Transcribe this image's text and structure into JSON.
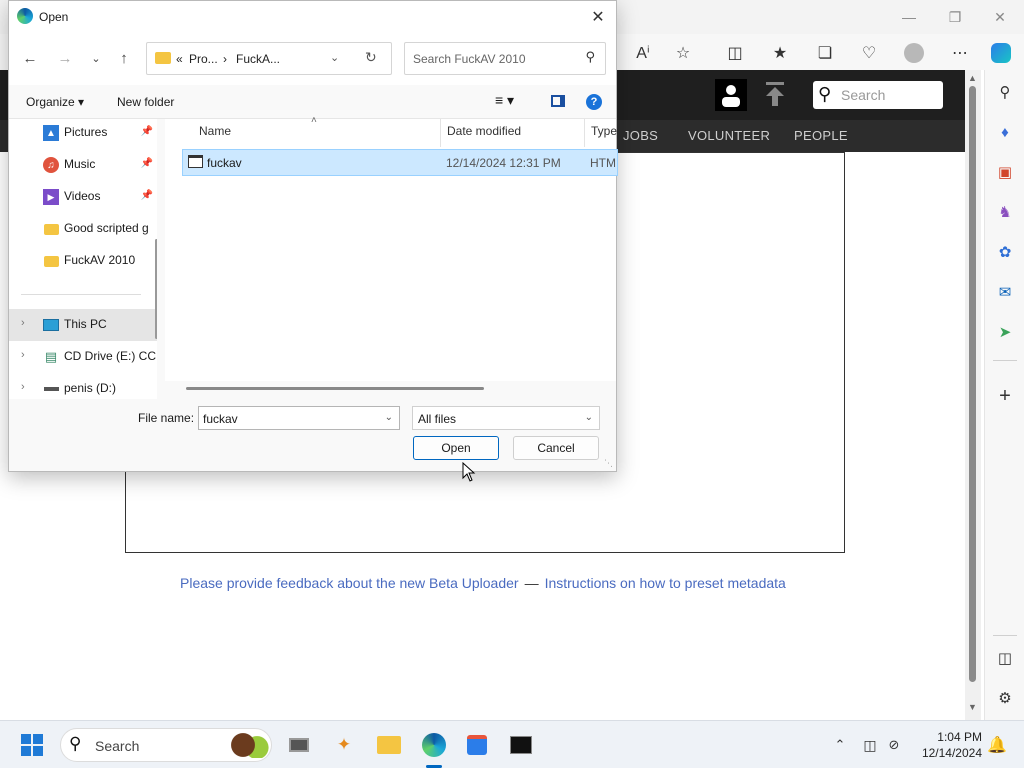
{
  "dialog": {
    "title": "Open",
    "address_segments": [
      "«",
      "Pro...",
      "›",
      "FuckA..."
    ],
    "search_placeholder": "Search FuckAV 2010",
    "organize_label": "Organize ▾",
    "new_folder_label": "New folder",
    "nav_items": [
      {
        "label": "Pictures",
        "icon": "pictures-icon",
        "pinned": true
      },
      {
        "label": "Music",
        "icon": "music-icon",
        "pinned": true
      },
      {
        "label": "Videos",
        "icon": "videos-icon",
        "pinned": true
      },
      {
        "label": "Good scripted g",
        "icon": "folder-icon",
        "pinned": false
      },
      {
        "label": "FuckAV 2010",
        "icon": "folder-icon",
        "pinned": false
      },
      {
        "label": "This PC",
        "icon": "pc-icon",
        "pinned": false
      },
      {
        "label": "CD Drive (E:) CC",
        "icon": "cd-drive-icon",
        "pinned": false
      },
      {
        "label": "penis (D:)",
        "icon": "drive-icon",
        "pinned": false
      }
    ],
    "columns": [
      "Name",
      "Date modified",
      "Type"
    ],
    "files": [
      {
        "name": "fuckav",
        "date": "12/14/2024 12:31 PM",
        "type": "HTM"
      }
    ],
    "file_name_label": "File name:",
    "file_name_value": "fuckav",
    "file_type_value": "All files",
    "open_label": "Open",
    "cancel_label": "Cancel"
  },
  "site": {
    "search_placeholder": "Search",
    "nav": [
      "JOBS",
      "VOLUNTEER",
      "PEOPLE"
    ],
    "feedback_link": "Please provide feedback about the new Beta Uploader",
    "separator": "—",
    "instructions_link": "Instructions on how to preset metadata"
  },
  "taskbar": {
    "search_label": "Search",
    "time": "1:04 PM",
    "date": "12/14/2024"
  },
  "colors": {
    "accent": "#0067c0",
    "selection": "#cce8ff",
    "link": "#4a6bc0",
    "header_dark": "#1f1f1f"
  }
}
